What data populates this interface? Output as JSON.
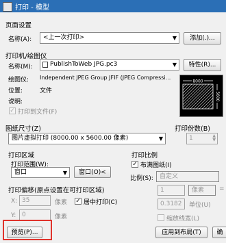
{
  "window": {
    "title": "打印 - 模型"
  },
  "page_setup": {
    "heading": "页面设置",
    "name_label": "名称(A):",
    "name_value": "<上一次打印>",
    "add_button": "添加(.)..."
  },
  "printer": {
    "heading": "打印机/绘图仪",
    "name_label": "名称(M):",
    "name_value": "PublishToWeb JPG.pc3",
    "properties_button": "特性(R)...",
    "plotter_label": "绘图仪:",
    "plotter_value": "Independent JPEG Group JFIF (JPEG Compressi...",
    "location_label": "位置:",
    "location_value": "文件",
    "desc_label": "说明:",
    "plot_to_file_label": "打印到文件(F)",
    "plot_to_file_checked": true,
    "preview_width_label": "8000",
    "preview_height_label": "5600"
  },
  "paper_size": {
    "heading": "图纸尺寸(Z)",
    "value": "图片虚拟打印 (8000.00 x 5600.00 像素)"
  },
  "copies": {
    "heading": "打印份数(B)",
    "value": "1"
  },
  "plot_area": {
    "heading": "打印区域",
    "range_label": "打印范围(W):",
    "range_value": "窗口",
    "window_button": "窗口(O)<"
  },
  "plot_scale": {
    "heading": "打印比例",
    "fit_label": "布满图纸(I)",
    "fit_checked": true,
    "scale_label": "比例(S):",
    "scale_value": "自定义",
    "value1": "1",
    "unit1": "像素",
    "value2": "0.3182",
    "unit2": "单位(U)",
    "lineweight_label": "缩放线宽(L)"
  },
  "plot_offset": {
    "heading": "打印偏移(原点设置在可打印区域)",
    "x_label": "X:",
    "x_value": "35",
    "x_unit": "像素",
    "center_label": "居中打印(C)",
    "center_checked": true,
    "y_label": "Y:",
    "y_value": "0",
    "y_unit": "像素"
  },
  "footer": {
    "preview_button": "预览(P)...",
    "apply_layout_button": "应用到布局(T)",
    "ok_button": "确"
  },
  "colors": {
    "titlebar": "#2b6fb6",
    "highlight": "#e0332c"
  }
}
